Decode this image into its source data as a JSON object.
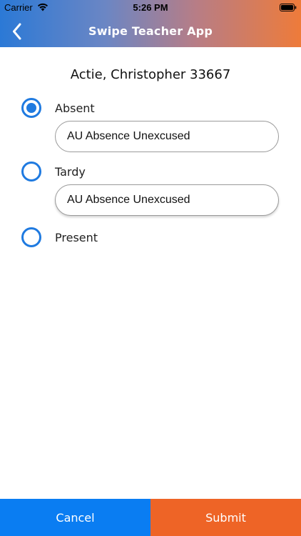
{
  "status_bar": {
    "carrier": "Carrier",
    "time": "5:26 PM"
  },
  "nav": {
    "title": "Swipe Teacher App",
    "back_icon": "chevron-left-icon"
  },
  "student": {
    "name": "Actie, Christopher 33667"
  },
  "options": [
    {
      "label": "Absent",
      "selected": true
    },
    {
      "label": "Tardy",
      "selected": false
    },
    {
      "label": "Present",
      "selected": false
    }
  ],
  "reasons": {
    "absent_reason": "AU Absence Unexcused",
    "tardy_reason": "AU Absence Unexcused"
  },
  "actions": {
    "cancel_label": "Cancel",
    "submit_label": "Submit"
  },
  "colors": {
    "accent_blue": "#1f7ae0",
    "cancel_blue": "#0a7df2",
    "submit_orange": "#ee6426"
  }
}
